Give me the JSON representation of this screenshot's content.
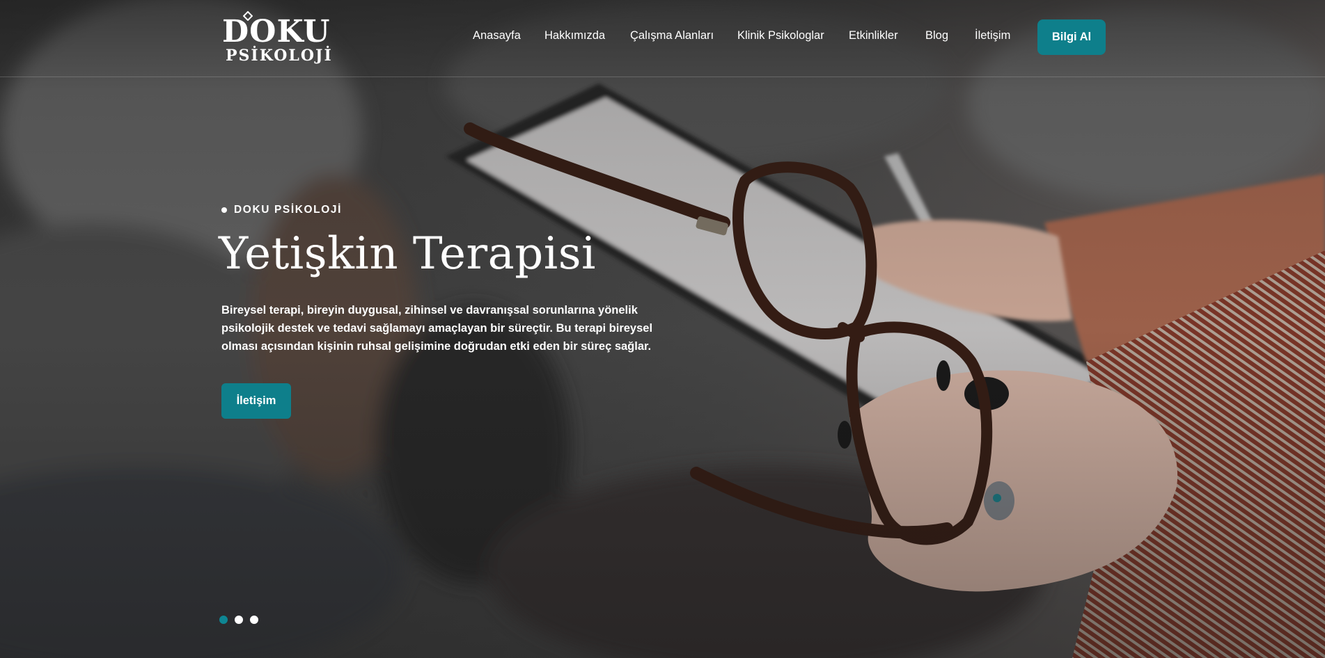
{
  "brand": {
    "logo_top": "DOKU",
    "logo_bottom": "PSİKOLOJİ"
  },
  "nav": {
    "items": [
      {
        "label": "Anasayfa"
      },
      {
        "label": "Hakkımızda"
      },
      {
        "label": "Çalışma Alanları"
      },
      {
        "label": "Klinik Psikologlar"
      },
      {
        "label": "Etkinlikler"
      },
      {
        "label": "Blog"
      },
      {
        "label": "İletişim"
      }
    ],
    "cta_label": "Bilgi Al"
  },
  "hero": {
    "eyebrow": "DOKU PSİKOLOJİ",
    "title": "Yetişkin Terapisi",
    "description": "Bireysel terapi, bireyin duygusal, zihinsel ve davranışsal sorunlarına yönelik psikolojik destek ve tedavi sağlamayı amaçlayan bir süreçtir. Bu terapi bireysel olması açısından kişinin ruhsal gelişimine doğrudan etki eden bir süreç sağlar.",
    "button_label": "İletişim",
    "slide_count": 3,
    "active_slide": 1
  },
  "colors": {
    "accent": "#0e7f8b",
    "active_dot": "#0e8693",
    "text": "#ffffff"
  },
  "icons": {
    "logo_mark": "diamond-icon",
    "eyebrow_marker": "dot-icon"
  }
}
